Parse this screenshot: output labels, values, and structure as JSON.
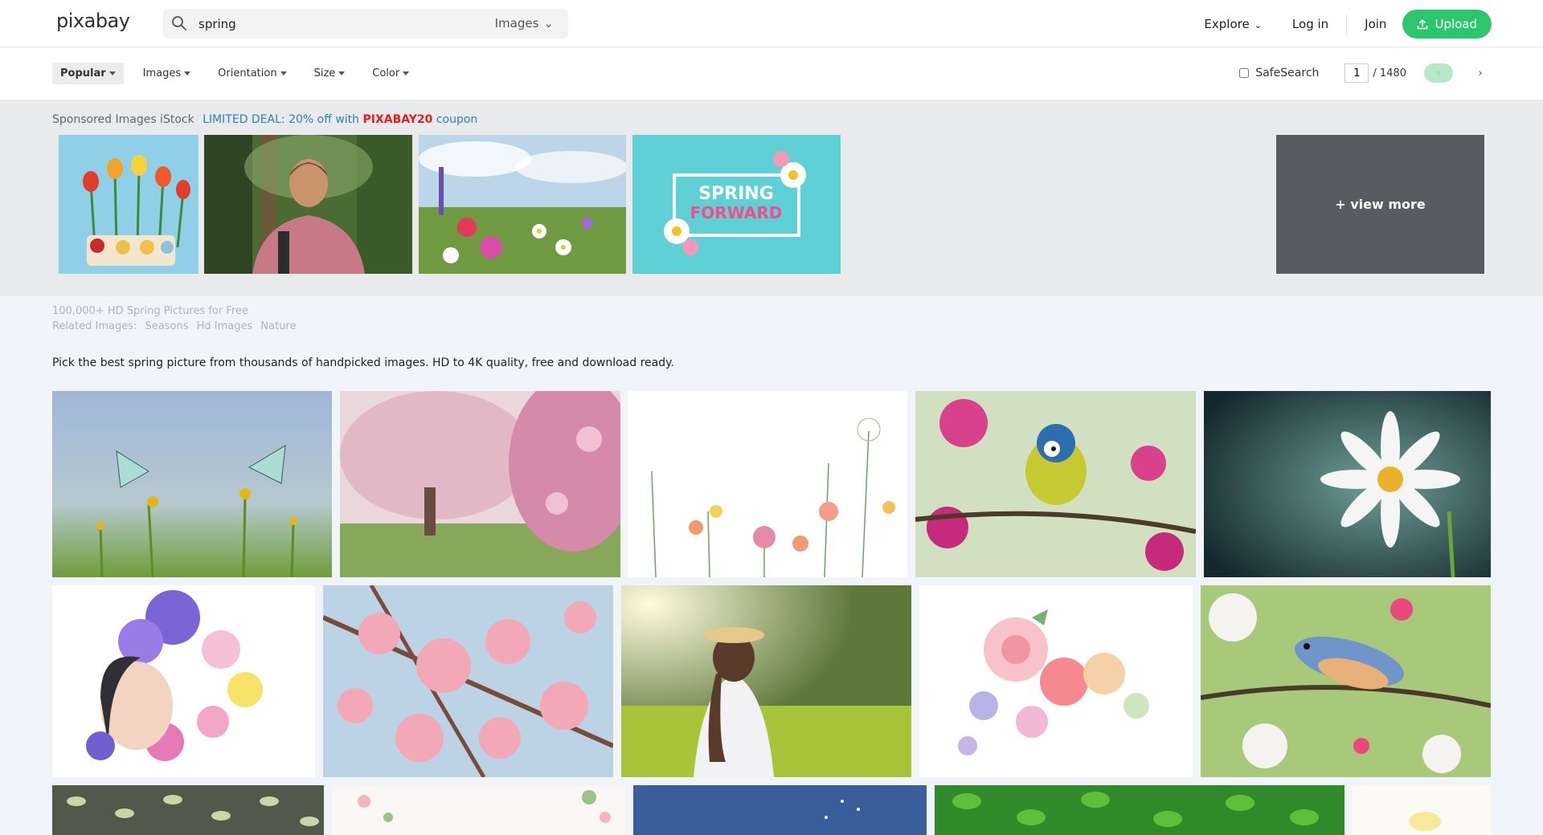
{
  "header": {
    "logo": "pixabay",
    "search_value": "spring",
    "search_type": "Images",
    "explore_label": "Explore",
    "login_label": "Log in",
    "join_label": "Join",
    "upload_label": "Upload"
  },
  "filters": {
    "popular": "Popular",
    "images": "Images",
    "orientation": "Orientation",
    "size": "Size",
    "color": "Color",
    "safesearch": "SafeSearch",
    "page_current": "1",
    "page_total": "/ 1480"
  },
  "sponsored": {
    "label": "Sponsored Images iStock",
    "deal_prefix": "LIMITED DEAL: 20% off with",
    "deal_code": "PIXABAY20",
    "deal_suffix": "coupon",
    "spring_text_1": "SPRING",
    "spring_text_2": "FORWARD",
    "view_more": "+ view more"
  },
  "info": {
    "title": "100,000+ HD Spring Pictures for Free",
    "related_label": "Related Images:",
    "related": [
      "Seasons",
      "Hd Images",
      "Nature"
    ],
    "description": "Pick the best spring picture from thousands of handpicked images. HD to 4K quality, free and download ready."
  },
  "colors": {
    "brand_green": "#2ec66d",
    "deal_blue": "#2b7fc2",
    "deal_red": "#e51d1d"
  }
}
